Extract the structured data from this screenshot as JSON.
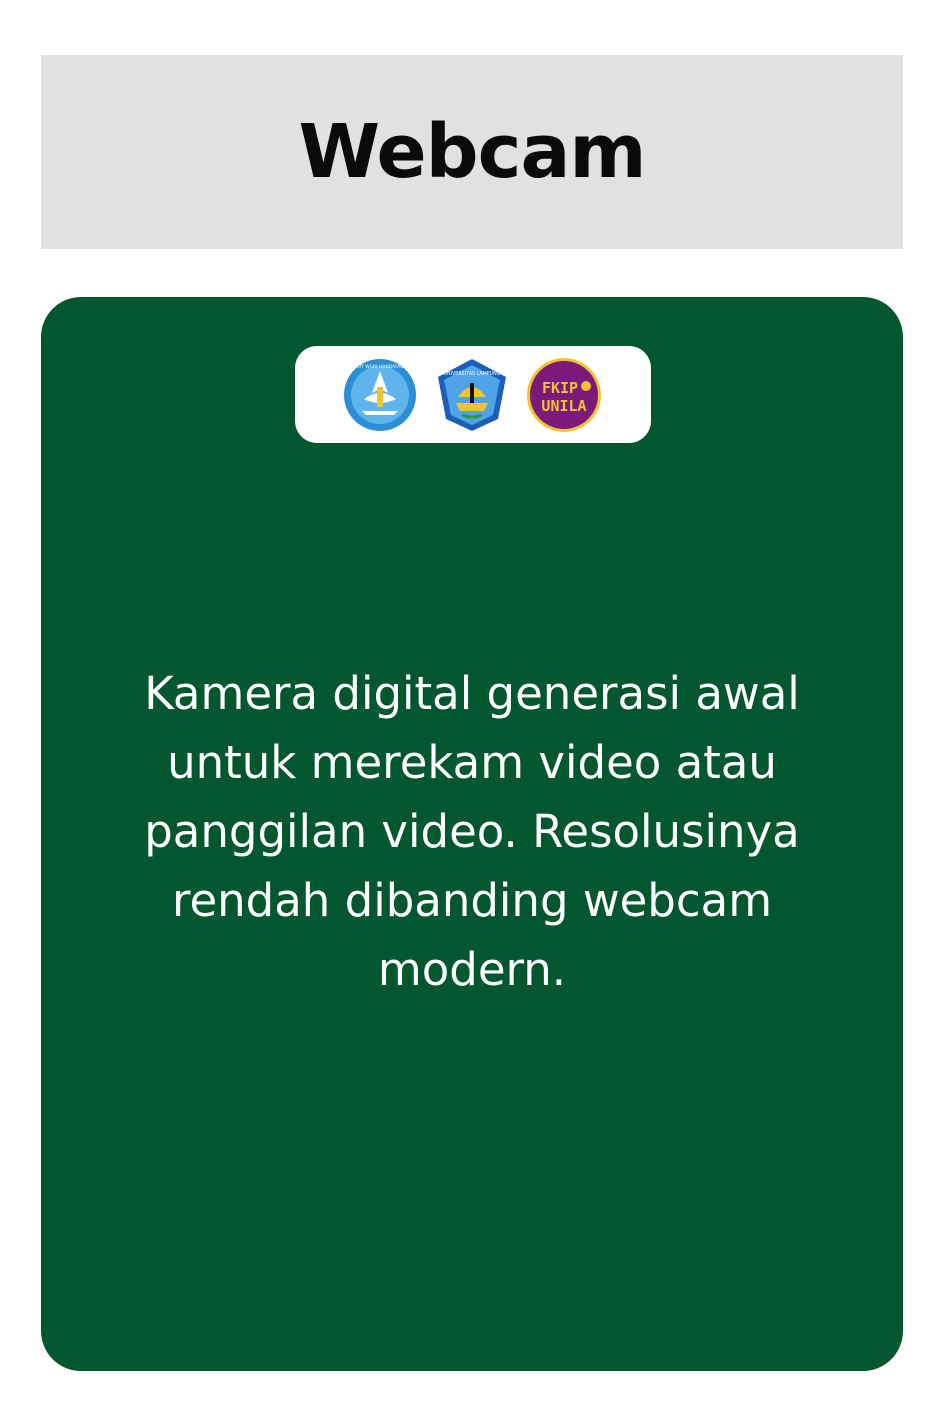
{
  "header": {
    "title": "Webcam"
  },
  "card": {
    "background_color": "#02572f",
    "logos": [
      {
        "icon": "tut-wuri-handayani-logo",
        "text": "TUT WURI HANDAYANI"
      },
      {
        "icon": "universitas-lampung-logo",
        "text": "UNIVERSITAS LAMPUNG"
      },
      {
        "icon": "fkip-unila-logo",
        "text_line1": "FKIP",
        "text_line2": "UNILA"
      }
    ],
    "description": "Kamera digital generasi awal untuk merekam video atau panggilan video. Resolusinya rendah dibanding webcam modern."
  },
  "colors": {
    "header_bg": "#e1e1e1",
    "card_bg": "#02572f",
    "fkip_purple": "#7b1a7a",
    "fkip_gold": "#f2c230",
    "kemendikbud_blue": "#2a8fd6",
    "unila_blue": "#1c5fb8"
  }
}
